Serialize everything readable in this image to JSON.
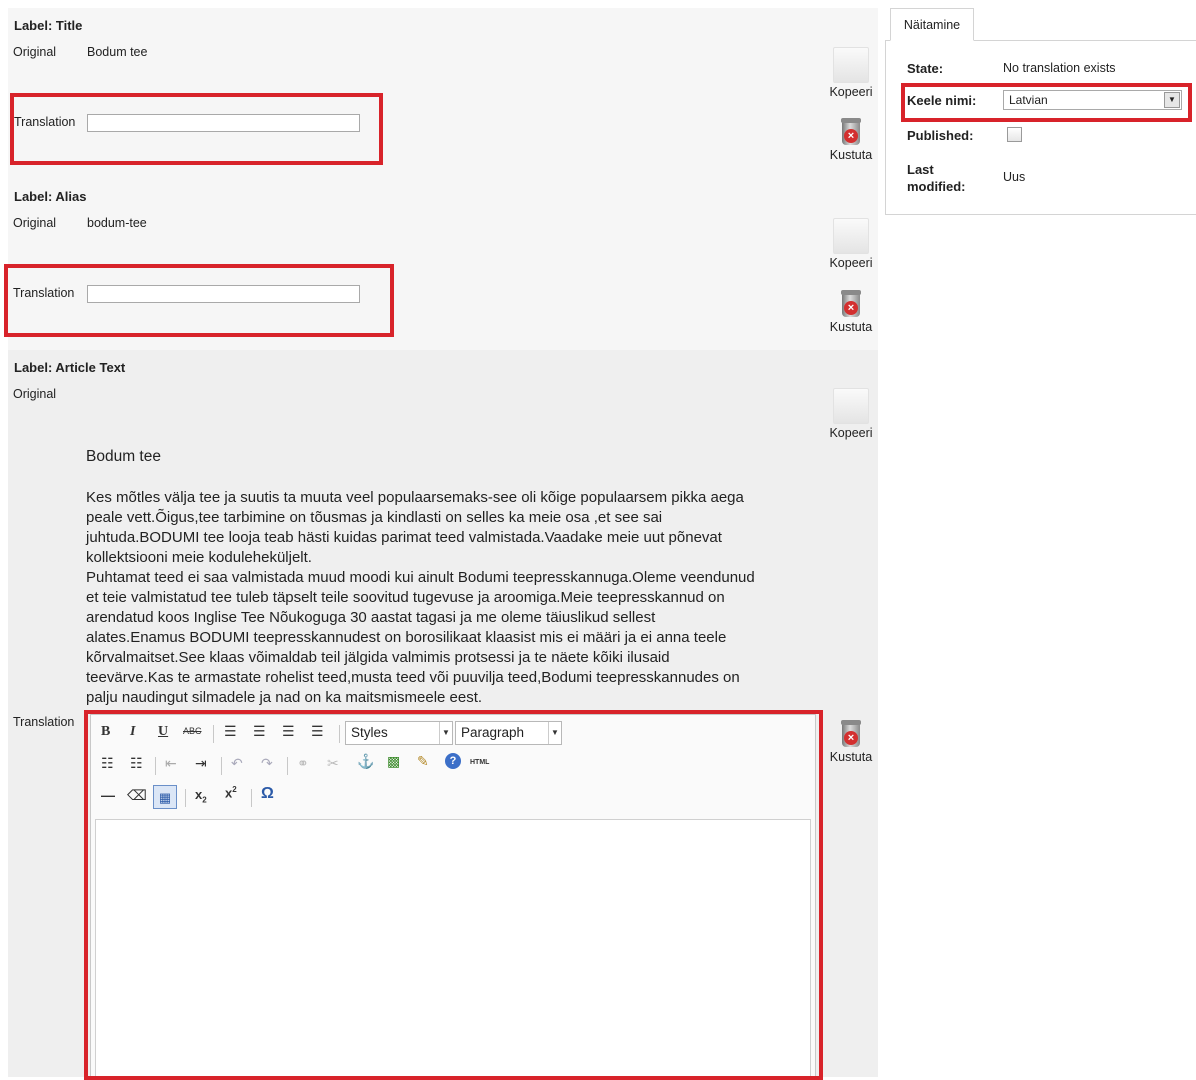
{
  "title_section": {
    "label": "Label: Title",
    "original_label": "Original",
    "original_value": "Bodum tee",
    "translation_label": "Translation",
    "translation_value": ""
  },
  "alias_section": {
    "label": "Label: Alias",
    "original_label": "Original",
    "original_value": "bodum-tee",
    "translation_label": "Translation",
    "translation_value": ""
  },
  "article_section": {
    "label": "Label: Article Text",
    "original_label": "Original",
    "heading": "Bodum tee",
    "lines": [
      "Kes mõtles välja tee ja suutis ta muuta veel populaarsemaks-see oli kõige populaarsem pikka aega",
      "peale vett.Õigus,tee tarbimine on tõusmas ja  kindlasti on selles ka meie osa ,et see sai",
      "juhtuda.BODUMI tee looja teab hästi kuidas parimat teed valmistada.Vaadake meie uut põnevat",
      "kollektsiooni meie koduleheküljelt.",
      "Puhtamat teed ei saa valmistada muud moodi kui ainult Bodumi teepresskannuga.Oleme veendunud",
      "et teie valmistatud tee tuleb täpselt teile soovitud tugevuse ja aroomiga.Meie teepresskannud on",
      "arendatud koos Inglise Tee Nõukoguga  30 aastat tagasi ja me oleme täiuslikud sellest",
      "alates.Enamus BODUMI teepresskannudest on borosilikaat klaasist mis ei määri ja ei anna teele",
      "kõrvalmaitset.See klaas võimaldab teil jälgida valmimis protsessi ja te näete kõiki ilusaid",
      "teevärve.Kas te armastate rohelist teed,musta teed või puuvilja teed,Bodumi teepresskannudes on",
      "palju naudingut silmadele ja nad on ka maitsmismeele eest."
    ],
    "translation_label": "Translation"
  },
  "editor": {
    "styles_value": "Styles",
    "format_value": "Paragraph",
    "html_label": "HTML",
    "content": ""
  },
  "actions": {
    "copy_label": "Kopeeri",
    "delete_label": "Kustuta"
  },
  "side_panel": {
    "tab_label": "Näitamine",
    "state_label": "State:",
    "state_value": "No translation exists",
    "language_label": "Keele nimi:",
    "language_value": "Latvian",
    "published_label": "Published:",
    "published_checked": false,
    "modified_label_line1": "Last",
    "modified_label_line2": "modified:",
    "modified_value": "Uus"
  },
  "colors": {
    "highlight_red": "#d8232a",
    "section_bg": "#f5f5f5",
    "article_bg": "#efefef"
  }
}
